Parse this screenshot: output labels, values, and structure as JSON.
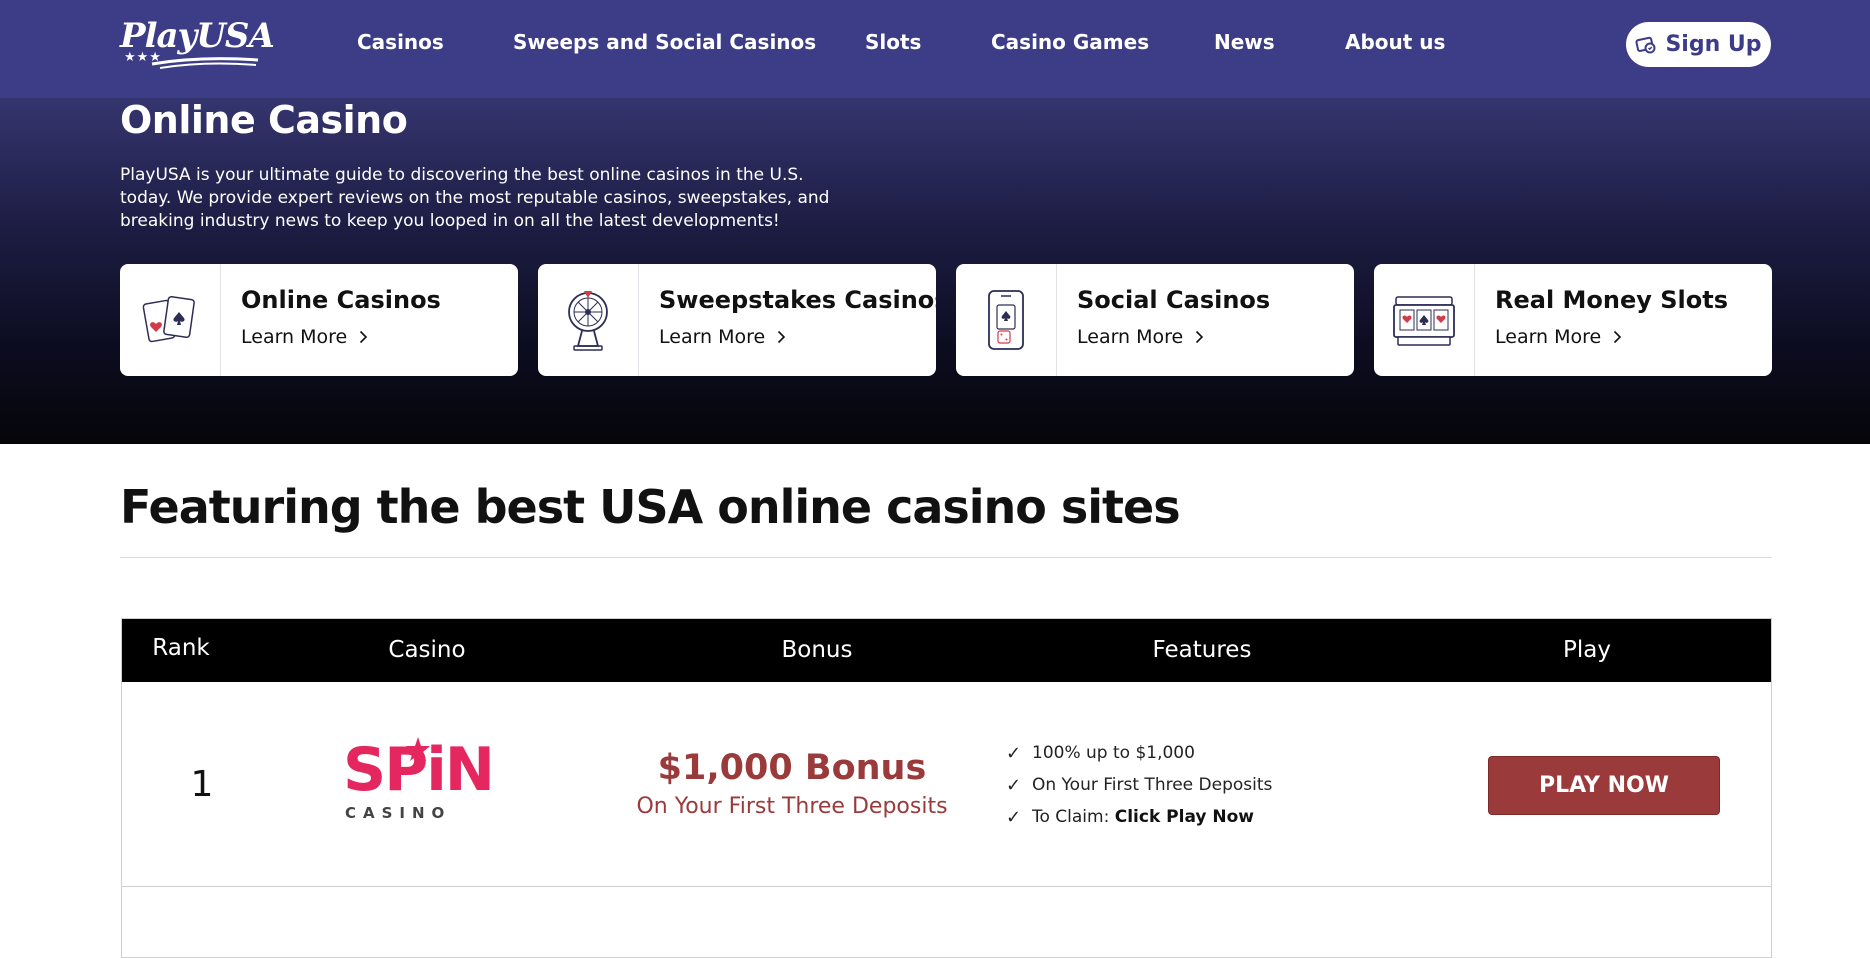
{
  "header": {
    "logo_text": "PlayUSA",
    "nav": [
      {
        "label": "Casinos"
      },
      {
        "label": "Sweeps and Social Casinos"
      },
      {
        "label": "Slots"
      },
      {
        "label": "Casino Games"
      },
      {
        "label": "News"
      },
      {
        "label": "About us"
      }
    ],
    "signup_label": "Sign Up",
    "signup_icon": "ticket-icon"
  },
  "hero": {
    "title": "Online Casino",
    "description": "PlayUSA is your ultimate guide to discovering the best online casinos in the U.S. today.  We provide expert reviews on the most reputable casinos, sweepstakes, and breaking industry news to keep you looped in on all the latest developments!",
    "cards": [
      {
        "title": "Online Casinos",
        "link": "Learn More",
        "icon": "playing-cards-icon"
      },
      {
        "title": "Sweepstakes Casinos",
        "link": "Learn More",
        "icon": "prize-wheel-icon"
      },
      {
        "title": "Social Casinos",
        "link": "Learn More",
        "icon": "phone-cards-icon"
      },
      {
        "title": "Real Money Slots",
        "link": "Learn More",
        "icon": "slot-machine-icon"
      }
    ]
  },
  "featured": {
    "title": "Featuring the best USA online casino sites",
    "columns": [
      "Rank",
      "Casino",
      "Bonus",
      "Features",
      "Play"
    ],
    "rows": [
      {
        "rank": "1",
        "casino_logo_text": "SPiN",
        "casino_logo_sub": "CASINO",
        "bonus_amount": "$1,000 Bonus",
        "bonus_sub": "On Your First Three Deposits",
        "features": [
          {
            "text": "100% up to $1,000",
            "strong": ""
          },
          {
            "text": "On Your First Three Deposits",
            "strong": ""
          },
          {
            "text": "To Claim: ",
            "strong": "Click Play Now"
          }
        ],
        "play_label": "PLAY NOW"
      }
    ]
  },
  "colors": {
    "header_bg": "#3c3c87",
    "accent_red": "#9b3a3b",
    "spin_pink": "#e5275f"
  }
}
